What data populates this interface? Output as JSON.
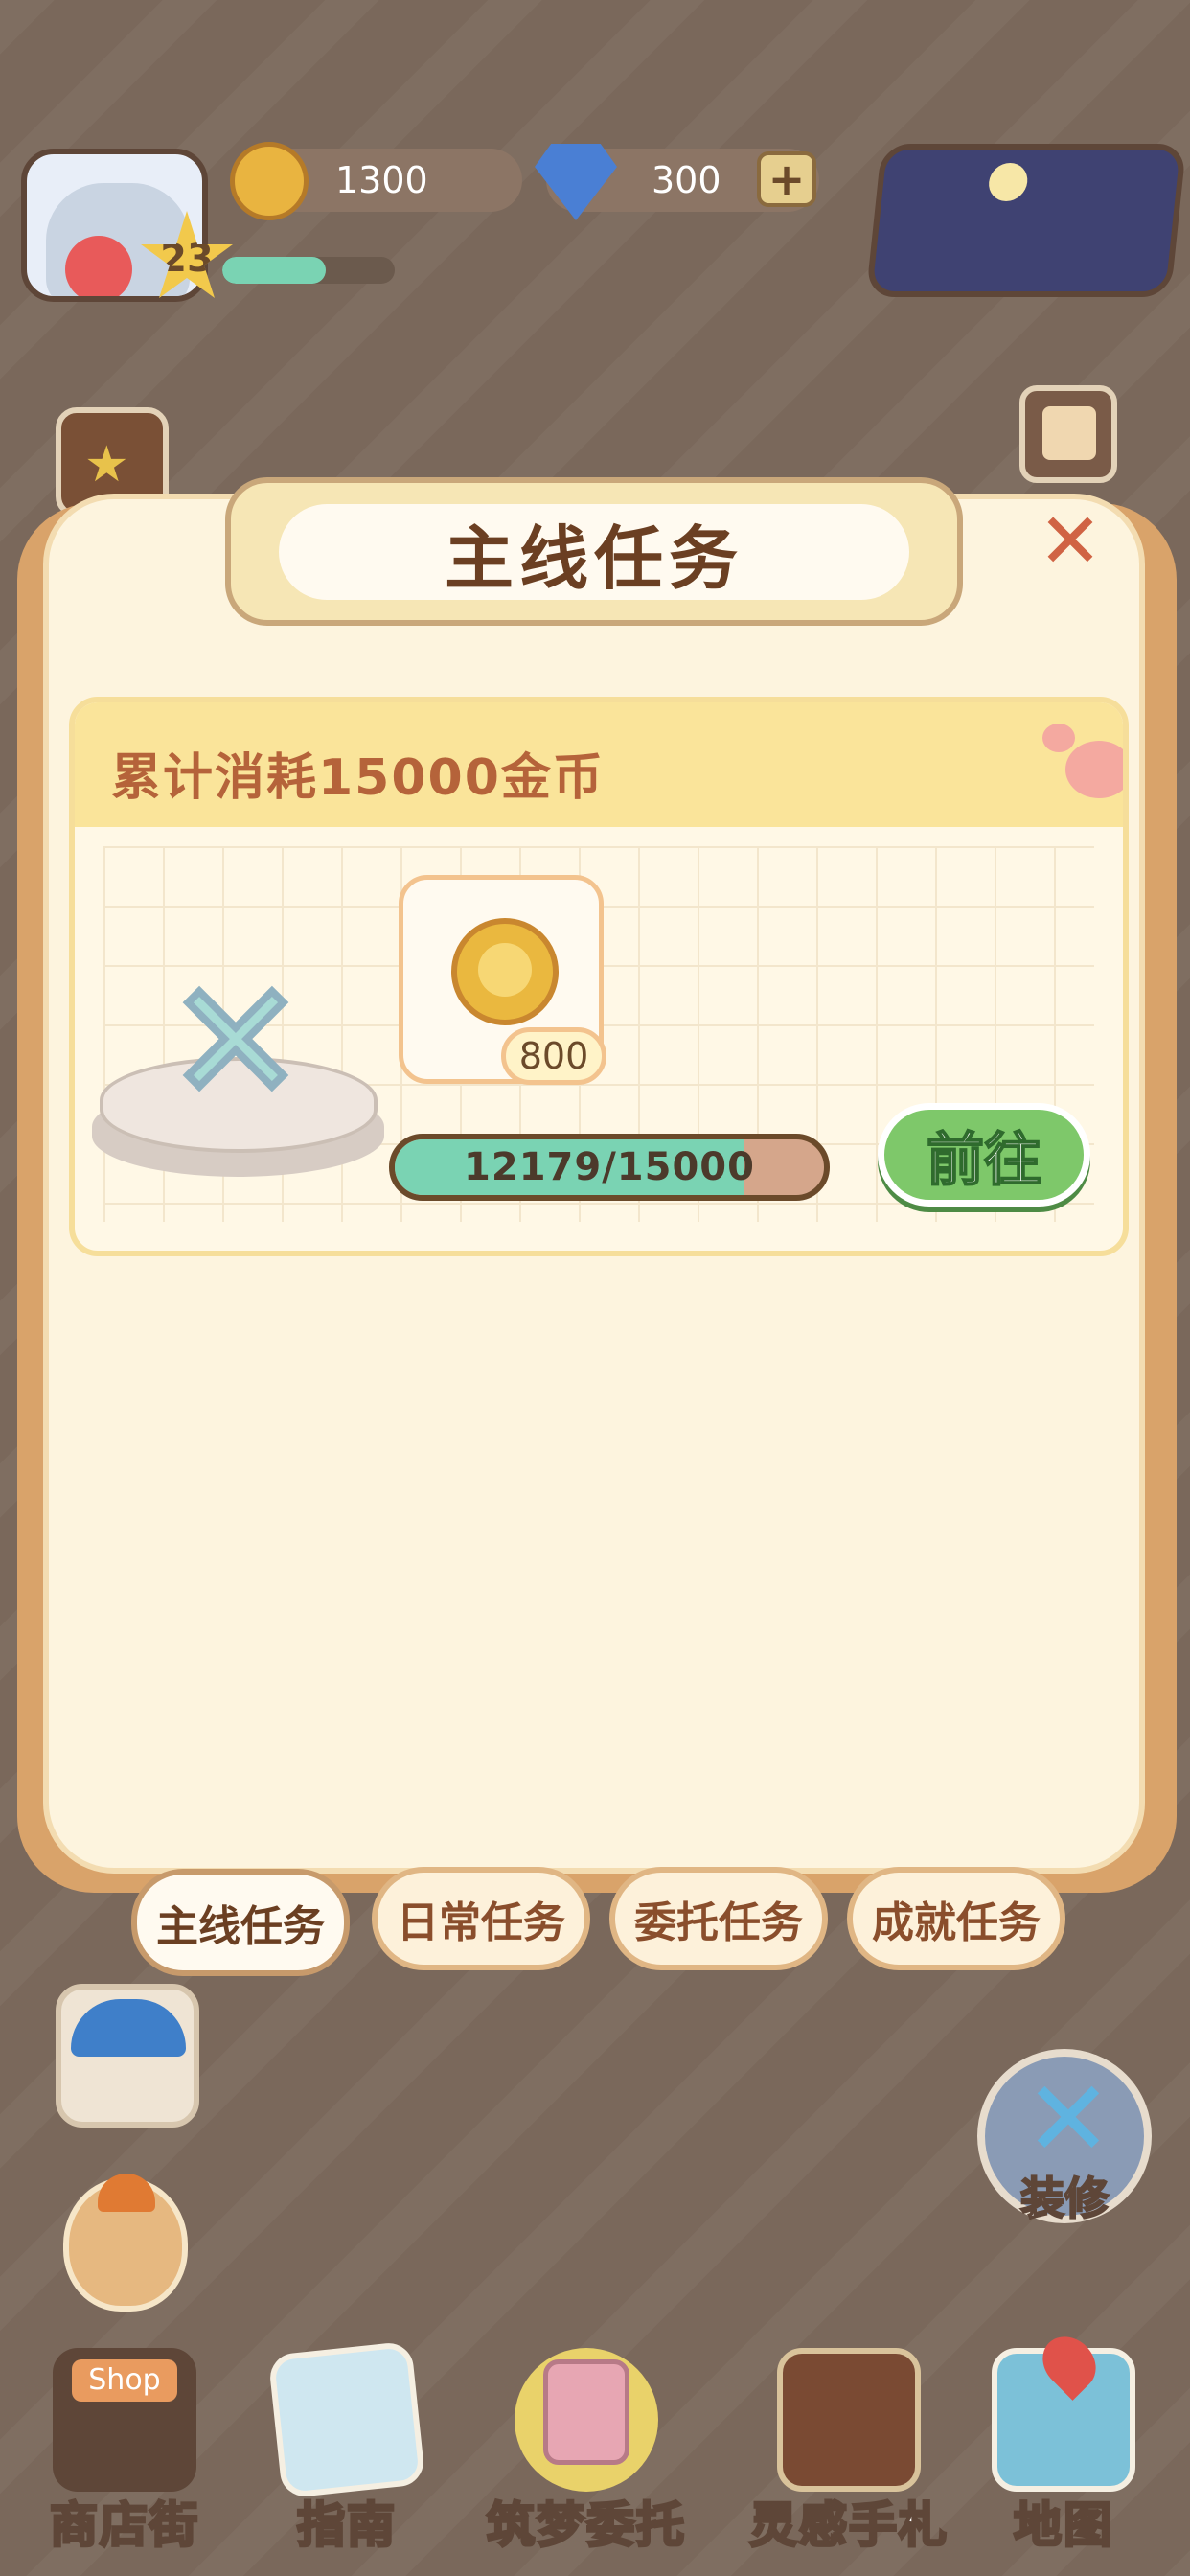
{
  "hud": {
    "player_level": "23",
    "xp_fraction": 0.6,
    "coins": "1300",
    "gems": "300",
    "add_gems_label": "+"
  },
  "dialog": {
    "title": "主线任务",
    "close_label": "✕",
    "task": {
      "description": "累计消耗15000金币",
      "reward_amount": "800",
      "progress_text": "12179/15000",
      "progress_current": 12179,
      "progress_target": 15000,
      "go_button": "前往"
    },
    "tabs": [
      {
        "label": "主线任务",
        "active": true
      },
      {
        "label": "日常任务",
        "active": false
      },
      {
        "label": "委托任务",
        "active": false
      },
      {
        "label": "成就任务",
        "active": false
      }
    ]
  },
  "side": {
    "renovate_label": "装修",
    "renovate_icon": "hammer-icon"
  },
  "bottom_nav": {
    "items": [
      {
        "label": "商店街",
        "icon": "shop-icon",
        "sign": "Shop"
      },
      {
        "label": "指南",
        "icon": "guide-book-icon"
      },
      {
        "label": "筑梦委托",
        "icon": "notebook-icon"
      },
      {
        "label": "灵感手札",
        "icon": "quill-book-icon"
      },
      {
        "label": "地图",
        "icon": "map-pin-icon"
      }
    ]
  },
  "colors": {
    "background": "#7a685b",
    "panel": "#fdf4de",
    "progress_fill": "#7ad3b3",
    "go_button": "#7ec86a"
  }
}
